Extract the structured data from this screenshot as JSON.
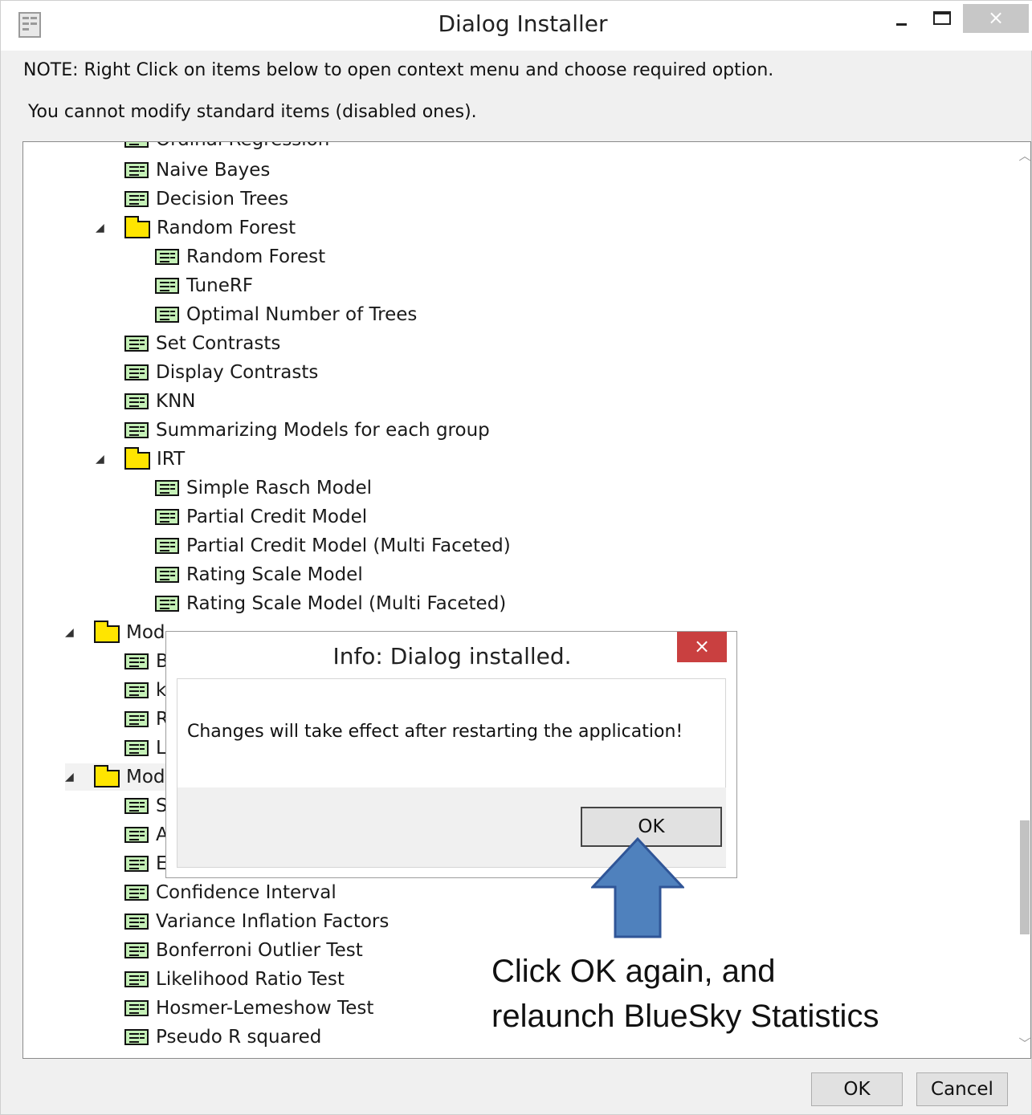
{
  "window": {
    "title": "Dialog Installer",
    "close_glyph": "×",
    "note_line1": "NOTE: Right Click on items below to open context menu and choose required option.",
    "note_line2": "You cannot modify standard items (disabled ones)."
  },
  "tree": {
    "clipped_top_label": "Ordinal Regression",
    "items": [
      {
        "label": "Naive Bayes",
        "type": "item"
      },
      {
        "label": "Decision Trees",
        "type": "item"
      },
      {
        "label": "Random Forest",
        "type": "folder",
        "expanded": true
      },
      {
        "label": "Random Forest",
        "type": "item"
      },
      {
        "label": "TuneRF",
        "type": "item"
      },
      {
        "label": "Optimal Number of Trees",
        "type": "item"
      },
      {
        "label": "Set Contrasts",
        "type": "item"
      },
      {
        "label": "Display Contrasts",
        "type": "item"
      },
      {
        "label": "KNN",
        "type": "item"
      },
      {
        "label": "Summarizing Models for each group",
        "type": "item"
      },
      {
        "label": "IRT",
        "type": "folder",
        "expanded": true
      },
      {
        "label": "Simple Rasch Model",
        "type": "item"
      },
      {
        "label": "Partial Credit Model",
        "type": "item"
      },
      {
        "label": "Partial Credit Model (Multi Faceted)",
        "type": "item"
      },
      {
        "label": "Rating Scale Model",
        "type": "item"
      },
      {
        "label": "Rating Scale Model (Multi Faceted)",
        "type": "item"
      },
      {
        "label": "Mod",
        "type": "folder",
        "expanded": true
      },
      {
        "label": "B",
        "type": "item"
      },
      {
        "label": "k",
        "type": "item"
      },
      {
        "label": "R",
        "type": "item"
      },
      {
        "label": "L",
        "type": "item"
      },
      {
        "label": "Mod",
        "type": "folder",
        "expanded": true
      },
      {
        "label": "S",
        "type": "item"
      },
      {
        "label": "A",
        "type": "item"
      },
      {
        "label": "E",
        "type": "item"
      },
      {
        "label": "Confidence Interval",
        "type": "item"
      },
      {
        "label": "Variance Inflation Factors",
        "type": "item"
      },
      {
        "label": "Bonferroni Outlier Test",
        "type": "item"
      },
      {
        "label": "Likelihood Ratio Test",
        "type": "item"
      },
      {
        "label": "Hosmer-Lemeshow Test",
        "type": "item"
      },
      {
        "label": "Pseudo R squared",
        "type": "item"
      }
    ]
  },
  "footer": {
    "ok_label": "OK",
    "cancel_label": "Cancel"
  },
  "info_dialog": {
    "title": "Info: Dialog installed.",
    "close_glyph": "×",
    "message": "Changes will take effect after restarting the application!",
    "ok_label": "OK"
  },
  "annotation": {
    "line1": "Click OK again, and",
    "line2": "relaunch BlueSky Statistics",
    "arrow_color": "#4f81bd"
  }
}
